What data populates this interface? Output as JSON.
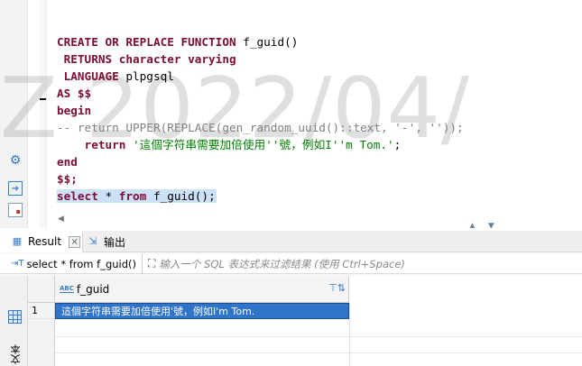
{
  "editor": {
    "watermark": "Z 2022/04/",
    "lines": [
      {
        "tokens": [
          {
            "t": "CREATE OR REPLACE FUNCTION",
            "c": "kw"
          },
          {
            "t": " f_guid()",
            "c": "id"
          }
        ]
      },
      {
        "tokens": [
          {
            "t": " RETURNS character varying",
            "c": "kw"
          }
        ]
      },
      {
        "tokens": [
          {
            "t": " LANGUAGE",
            "c": "kw"
          },
          {
            "t": " plpgsql",
            "c": "id"
          }
        ]
      },
      {
        "tokens": [
          {
            "t": "AS $$",
            "c": "kw"
          }
        ]
      },
      {
        "tokens": [
          {
            "t": "begin",
            "c": "kw"
          }
        ]
      },
      {
        "tokens": [
          {
            "t": "-- return UPPER(REPLACE(gen_random_uuid()::text, '-', ''));",
            "c": "cmt"
          }
        ]
      },
      {
        "tokens": [
          {
            "t": "    return",
            "c": "kw"
          },
          {
            "t": " ",
            "c": "id"
          },
          {
            "t": "'這個字符串需要加倍使用''號，例如I''m Tom.'",
            "c": "str"
          },
          {
            "t": ";",
            "c": "id"
          }
        ]
      },
      {
        "tokens": [
          {
            "t": "end",
            "c": "kw"
          }
        ]
      },
      {
        "tokens": [
          {
            "t": "$$;",
            "c": "kw"
          }
        ]
      },
      {
        "selected": true,
        "tokens": [
          {
            "t": "select",
            "c": "kw"
          },
          {
            "t": " * ",
            "c": "id"
          },
          {
            "t": "from",
            "c": "kw"
          },
          {
            "t": " f_guid();",
            "c": "id"
          }
        ]
      }
    ]
  },
  "results": {
    "tabs": {
      "result_label": "Result",
      "output_label": "输出"
    },
    "filter": {
      "query_label": "select * from f_guid()",
      "placeholder": "输入一个 SQL 表达式来过滤结果 (使用 Ctrl+Space)"
    },
    "side_tabs": {
      "grid_label": "网格",
      "text_label": "文本"
    },
    "grid": {
      "column_header": "f_guid",
      "rows": [
        {
          "num": "1",
          "value": "這個字符串需要加倍使用'號，例如I'm Tom."
        }
      ]
    }
  },
  "colors": {
    "keyword": "#7d0b36",
    "comment": "#808080",
    "string": "#008000",
    "selection": "#cce1f7",
    "accent": "#2f74c8"
  }
}
